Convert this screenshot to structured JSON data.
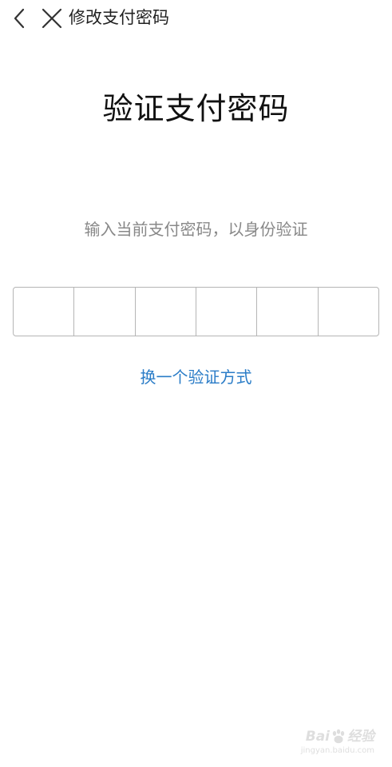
{
  "topbar": {
    "back_icon": "chevron-left-icon",
    "close_icon": "close-icon",
    "title": "修改支付密码"
  },
  "main": {
    "title": "验证支付密码",
    "subtitle": "输入当前支付密码，以身份验证",
    "pin": {
      "length": 6,
      "digits": [
        "",
        "",
        "",
        "",
        "",
        ""
      ]
    },
    "switch_link": "换一个验证方式",
    "link_color": "#2a7cc7"
  },
  "watermark": {
    "brand_left": "Bai",
    "brand_right": "经验",
    "url": "jingyan.baidu.com"
  }
}
